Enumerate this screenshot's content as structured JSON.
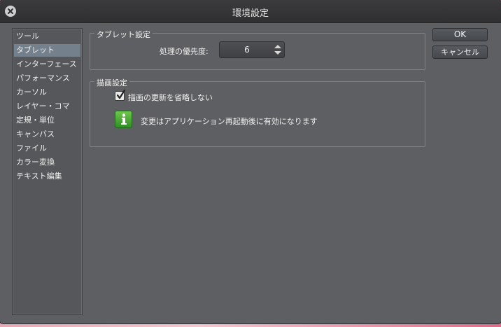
{
  "window": {
    "title": "環境設定"
  },
  "sidebar": {
    "items": [
      {
        "label": "ツール"
      },
      {
        "label": "タブレット"
      },
      {
        "label": "インターフェース"
      },
      {
        "label": "パフォーマンス"
      },
      {
        "label": "カーソル"
      },
      {
        "label": "レイヤー・コマ"
      },
      {
        "label": "定規・単位"
      },
      {
        "label": "キャンバス"
      },
      {
        "label": "ファイル"
      },
      {
        "label": "カラー変換"
      },
      {
        "label": "テキスト編集"
      }
    ],
    "selected": "タブレット"
  },
  "tablet_settings": {
    "title": "タブレット設定",
    "priority_label": "処理の優先度:",
    "priority_value": "6"
  },
  "drawing_settings": {
    "title": "描画設定",
    "skip_update_label": "描画の更新を省略しない",
    "skip_update_checked": true,
    "info_message": "変更はアプリケーション再起動後に有効になります"
  },
  "buttons": {
    "ok": "OK",
    "cancel": "キャンセル"
  },
  "icons": {
    "close": "close-icon",
    "info": "info-icon",
    "check": "checkmark-icon",
    "stepper": "up-down-arrows-icon"
  },
  "colors": {
    "window_bg": "#5e5f62",
    "selected_item": "#74808c",
    "info_green": "#3a9e2c"
  }
}
